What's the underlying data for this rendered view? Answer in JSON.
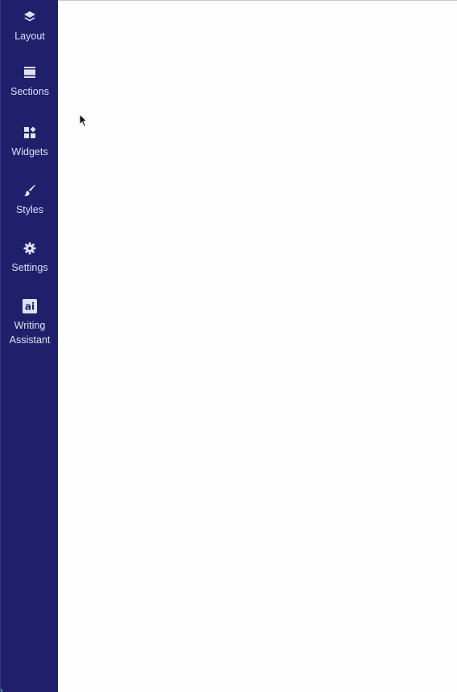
{
  "sidebar": {
    "background": "#1f1f6b",
    "items": [
      {
        "id": "layout",
        "label": "Layout",
        "icon": "layers-icon"
      },
      {
        "id": "sections",
        "label": "Sections",
        "icon": "sections-icon"
      },
      {
        "id": "widgets",
        "label": "Widgets",
        "icon": "widgets-icon"
      },
      {
        "id": "styles",
        "label": "Styles",
        "icon": "brush-icon"
      },
      {
        "id": "settings",
        "label": "Settings",
        "icon": "gear-icon"
      },
      {
        "id": "writing",
        "label": "Writing\nAssistant",
        "icon": "ai-icon",
        "icon_text": "ai"
      }
    ]
  },
  "canvas": {
    "background": "#fdfdfd"
  }
}
